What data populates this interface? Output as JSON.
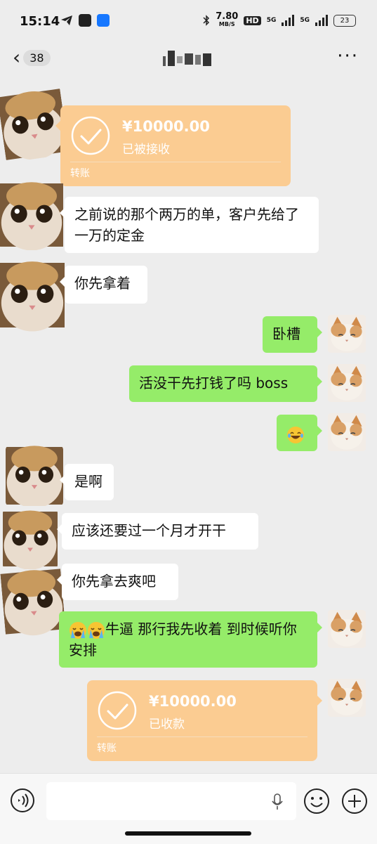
{
  "status_bar": {
    "time": "15:14",
    "speed_value": "7.80",
    "speed_unit": "MB/S",
    "hd": "HD",
    "network_1": "5G",
    "network_2": "5G",
    "battery": "23"
  },
  "nav": {
    "unread_count": "38",
    "more": "···"
  },
  "messages": [
    {
      "side": "left",
      "type": "transfer",
      "amount": "¥10000.00",
      "status": "已被接收",
      "kind": "转账"
    },
    {
      "side": "left",
      "type": "text",
      "text": "之前说的那个两万的单，客户先给了一万的定金"
    },
    {
      "side": "left",
      "type": "text",
      "text": "你先拿着"
    },
    {
      "side": "right",
      "type": "text",
      "text": "卧槽"
    },
    {
      "side": "right",
      "type": "text",
      "text": "活没干先打钱了吗 boss"
    },
    {
      "side": "right",
      "type": "emoji",
      "emoji": "😂"
    },
    {
      "side": "left",
      "type": "text",
      "text": "是啊"
    },
    {
      "side": "left",
      "type": "text",
      "text": "应该还要过一个月才开干"
    },
    {
      "side": "left",
      "type": "text",
      "text": "你先拿去爽吧"
    },
    {
      "side": "right",
      "type": "text",
      "text": "牛逼 那行我先收着 到时候听你安排",
      "emoji": "😭😭"
    },
    {
      "side": "right",
      "type": "transfer",
      "amount": "¥10000.00",
      "status": "已收款",
      "kind": "转账"
    }
  ],
  "colors": {
    "background": "#ededed",
    "bubble_self": "#95ec69",
    "bubble_other": "#ffffff",
    "transfer": "#fbcc92"
  },
  "icons": {
    "voice": "voice-mode-icon",
    "mic": "microphone-icon",
    "emoji": "emoji-smile-icon",
    "plus": "plus-icon"
  }
}
